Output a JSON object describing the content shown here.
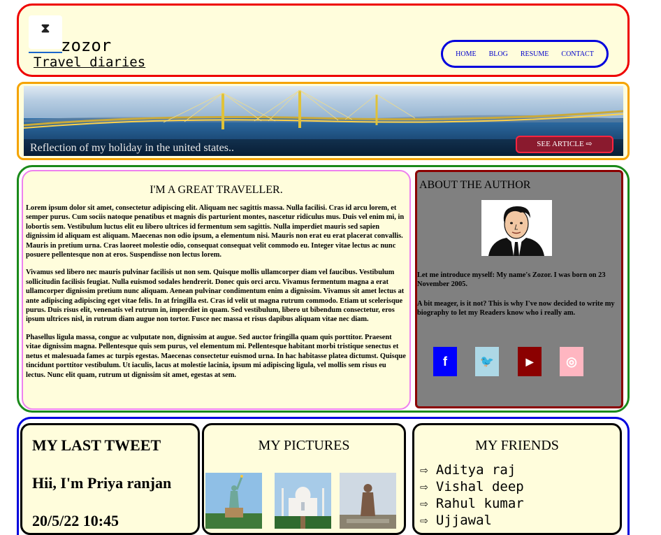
{
  "header": {
    "logo_symbol": "⧗",
    "brand": "zozor",
    "tagline": "Travel diaries",
    "nav": [
      "HOME",
      "BLOG",
      "RESUME",
      "CONTACT"
    ]
  },
  "banner": {
    "caption": "Reflection of my holiday in the united states..",
    "button": "SEE ARTICLE ⇨"
  },
  "article": {
    "title": "I'M A GREAT TRAVELLER.",
    "paragraphs": [
      "Lorem ipsum dolor sit amet, consectetur adipiscing elit. Aliquam nec sagittis massa. Nulla facilisi. Cras id arcu lorem, et semper purus. Cum sociis natoque penatibus et magnis dis parturient montes, nascetur ridiculus mus. Duis vel enim mi, in lobortis sem. Vestibulum luctus elit eu libero ultrices id fermentum sem sagittis. Nulla imperdiet mauris sed sapien dignissim id aliquam est aliquam. Maecenas non odio ipsum, a elementum nisi. Mauris non erat eu erat placerat convallis. Mauris in pretium urna. Cras laoreet molestie odio, consequat consequat velit commodo eu. Integer vitae lectus ac nunc posuere pellentesque non at eros. Suspendisse non lectus lorem.",
      "Vivamus sed libero nec mauris pulvinar facilisis ut non sem. Quisque mollis ullamcorper diam vel faucibus. Vestibulum sollicitudin facilisis feugiat. Nulla euismod sodales hendrerit. Donec quis orci arcu. Vivamus fermentum magna a erat ullamcorper dignissim pretium nunc aliquam. Aenean pulvinar condimentum enim a dignissim. Vivamus sit amet lectus at ante adipiscing adipiscing eget vitae felis. In at fringilla est. Cras id velit ut magna rutrum commodo. Etiam ut scelerisque purus. Duis risus elit, venenatis vel rutrum in, imperdiet in quam. Sed vestibulum, libero ut bibendum consectetur, eros ipsum ultrices nisl, in rutrum diam augue non tortor. Fusce nec massa et risus dapibus aliquam vitae nec diam.",
      "Phasellus ligula massa, congue ac vulputate non, dignissim at augue. Sed auctor fringilla quam quis porttitor. Praesent vitae dignissim magna. Pellentesque quis sem purus, vel elementum mi. Pellentesque habitant morbi tristique senectus et netus et malesuada fames ac turpis egestas. Maecenas consectetur euismod urna. In hac habitasse platea dictumst. Quisque tincidunt porttitor vestibulum. Ut iaculis, lacus at molestie lacinia, ipsum mi adipiscing ligula, vel mollis sem risus eu lectus. Nunc elit quam, rutrum ut dignissim sit amet, egestas at sem."
    ]
  },
  "about": {
    "title": "ABOUT THE AUTHOR",
    "intro": "Let me introduce myself: My name's Zozor. I was born on 23 November 2005.",
    "bio": "A bit meager, is it not? This is why I've now decided to write my biography to let my Readers know who i really am.",
    "social": [
      {
        "name": "facebook",
        "glyph": "f",
        "color": "#0000ff"
      },
      {
        "name": "twitter",
        "glyph": "🐦",
        "color": "#add8e6"
      },
      {
        "name": "youtube",
        "glyph": "▶",
        "color": "#8b0000"
      },
      {
        "name": "instagram",
        "glyph": "◎",
        "color": "#ffb6c1"
      }
    ]
  },
  "footer": {
    "tweet_title": "MY LAST TWEET",
    "tweet_text": "Hii, I'm Priya ranjan",
    "tweet_time": "20/5/22 10:45",
    "pictures_title": "MY PICTURES",
    "friends_title": "MY FRIENDS",
    "friends": [
      "Aditya raj",
      "Vishal deep",
      "Rahul kumar",
      "Ujjawal"
    ]
  }
}
